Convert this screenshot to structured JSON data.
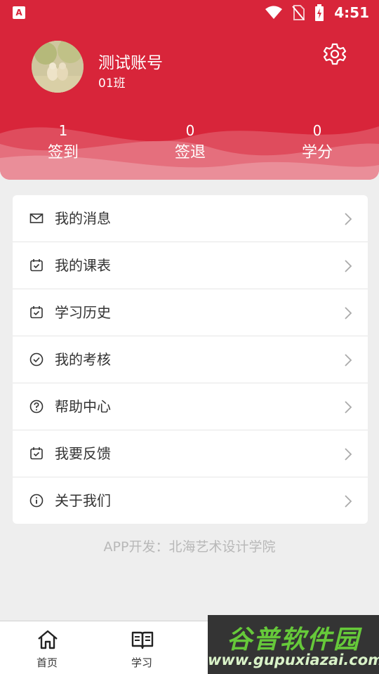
{
  "status_bar": {
    "app_icon_letter": "A",
    "time": "4:51"
  },
  "profile": {
    "username": "测试账号",
    "class_name": "01班"
  },
  "stats": [
    {
      "value": "1",
      "label": "签到"
    },
    {
      "value": "0",
      "label": "签退"
    },
    {
      "value": "0",
      "label": "学分"
    }
  ],
  "menu": [
    {
      "label": "我的消息",
      "icon": "mail-icon"
    },
    {
      "label": "我的课表",
      "icon": "calendar-check-icon"
    },
    {
      "label": "学习历史",
      "icon": "calendar-check-icon"
    },
    {
      "label": "我的考核",
      "icon": "check-circle-icon"
    },
    {
      "label": "帮助中心",
      "icon": "help-circle-icon"
    },
    {
      "label": "我要反馈",
      "icon": "calendar-check-icon"
    },
    {
      "label": "关于我们",
      "icon": "info-circle-icon"
    }
  ],
  "footer_note": "APP开发：北海艺术设计学院",
  "tabbar": [
    {
      "label": "首页",
      "icon": "home-icon"
    },
    {
      "label": "学习",
      "icon": "book-icon"
    }
  ],
  "watermark": {
    "title": "谷普软件园",
    "url": "www.gupuxiazai.com"
  },
  "colors": {
    "primary": "#d8253a",
    "background": "#eeeeee",
    "card": "#ffffff",
    "footer_text": "#b8b8b8"
  }
}
